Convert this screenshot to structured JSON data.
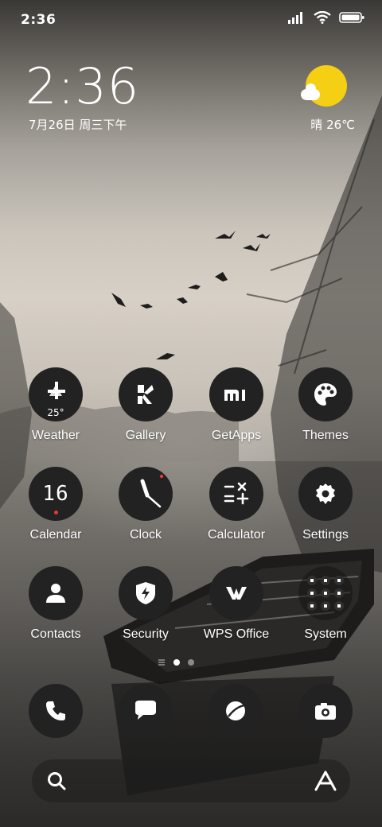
{
  "status_bar": {
    "time": "2:36"
  },
  "lock_clock": {
    "time": "2:36",
    "date": "7月26日 周三下午"
  },
  "weather": {
    "text": "晴 26℃",
    "sun_color": "#f5cf13"
  },
  "apps": [
    {
      "label": "Weather",
      "icon": "weather-icon",
      "badge": "25°"
    },
    {
      "label": "Gallery",
      "icon": "gallery-icon"
    },
    {
      "label": "GetApps",
      "icon": "getapps-icon"
    },
    {
      "label": "Themes",
      "icon": "themes-icon"
    },
    {
      "label": "Calendar",
      "icon": "calendar-icon",
      "badge": "16"
    },
    {
      "label": "Clock",
      "icon": "clock-icon"
    },
    {
      "label": "Calculator",
      "icon": "calculator-icon"
    },
    {
      "label": "Settings",
      "icon": "settings-icon"
    },
    {
      "label": "Contacts",
      "icon": "contacts-icon"
    },
    {
      "label": "Security",
      "icon": "security-icon"
    },
    {
      "label": "WPS Office",
      "icon": "wps-office-icon"
    },
    {
      "label": "System",
      "icon": "system-folder-icon"
    }
  ],
  "dock": [
    "phone-icon",
    "messages-icon",
    "browser-icon",
    "camera-icon"
  ],
  "page_indicator": {
    "pages": 2,
    "current": 1
  },
  "search": {
    "icon": "search-icon",
    "assistant_icon": "assistant-icon"
  },
  "colors": {
    "icon_bg": "#222222",
    "accent_red": "#e53935"
  }
}
